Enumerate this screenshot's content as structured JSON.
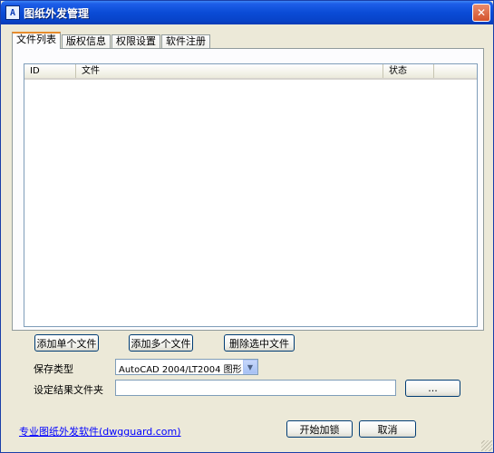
{
  "window": {
    "title": "图纸外发管理",
    "app_icon_glyph": "A",
    "close_glyph": "✕"
  },
  "tabs": [
    {
      "label": "文件列表",
      "active": true
    },
    {
      "label": "版权信息",
      "active": false
    },
    {
      "label": "权限设置",
      "active": false
    },
    {
      "label": "软件注册",
      "active": false
    }
  ],
  "file_list": {
    "columns": [
      "ID",
      "文件",
      "状态"
    ],
    "rows": []
  },
  "actions": {
    "add_single": "添加单个文件",
    "add_multiple": "添加多个文件",
    "delete_selected": "删除选中文件"
  },
  "save_type": {
    "label": "保存类型",
    "value": "AutoCAD 2004/LT2004 图形"
  },
  "output_folder": {
    "label": "设定结果文件夹",
    "value": "",
    "browse_label": "..."
  },
  "footer": {
    "link_text": "专业图纸外发软件(dwgguard.com)",
    "start_label": "开始加锁",
    "cancel_label": "取消"
  },
  "colors": {
    "titlebar": "#0a4bd6",
    "window_bg": "#ece9d8",
    "active_tab_accent": "#e68b2c",
    "link": "#0000ff"
  }
}
